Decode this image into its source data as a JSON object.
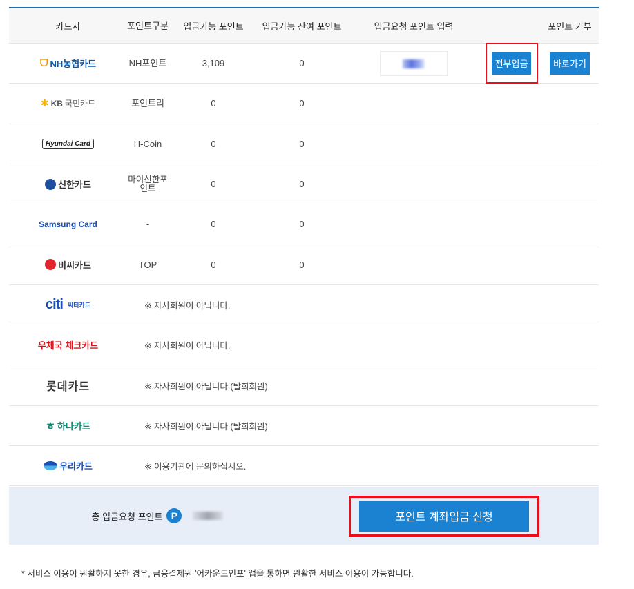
{
  "header": {
    "card_company": "카드사",
    "point_type": "포인트구분",
    "available_points": "입금가능 포인트",
    "remaining_points": "입금가능 잔여 포인트",
    "request_input": "입금요청 포인트 입력",
    "donate": "포인트 기부"
  },
  "rows": [
    {
      "logo": "NH농협카드",
      "type": "NH포인트",
      "points": "3,109",
      "remaining": "0",
      "all_button": "전부입금",
      "donate_button": "바로가기"
    },
    {
      "logo_mark": "KB",
      "logo": "국민카드",
      "type": "포인트리",
      "points": "0",
      "remaining": "0"
    },
    {
      "logo": "Hyundai Card",
      "type": "H-Coin",
      "points": "0",
      "remaining": "0"
    },
    {
      "logo": "신한카드",
      "type": "마이신한포인트",
      "points": "0",
      "remaining": "0"
    },
    {
      "logo": "Samsung Card",
      "type": "-",
      "points": "0",
      "remaining": "0"
    },
    {
      "logo": "비씨카드",
      "type": "TOP",
      "points": "0",
      "remaining": "0"
    },
    {
      "logo": "citi",
      "logo_sub": "씨티카드",
      "notice": "※ 자사회원이 아닙니다."
    },
    {
      "logo": "우체국 체크카드",
      "notice": "※ 자사회원이 아닙니다."
    },
    {
      "logo": "롯데카드",
      "notice": "※ 자사회원이 아닙니다.(탈회회원)"
    },
    {
      "logo": "하나카드",
      "notice": "※ 자사회원이 아닙니다.(탈회회원)"
    },
    {
      "logo": "우리카드",
      "notice": "※ 이용기관에 문의하십시오."
    }
  ],
  "footer": {
    "total_label": "총 입금요청 포인트",
    "badge": "P",
    "apply_button": "포인트 계좌입금 신청"
  },
  "bottom_note": "* 서비스 이용이 원활하지 못한 경우, 금융결제원 '어카운트인포' 앱을 통하면 원활한 서비스 이용이 가능합니다.",
  "colors": {
    "accent": "#1a82d1",
    "highlight": "#e8101c",
    "footer_bg": "#e8eef8"
  }
}
